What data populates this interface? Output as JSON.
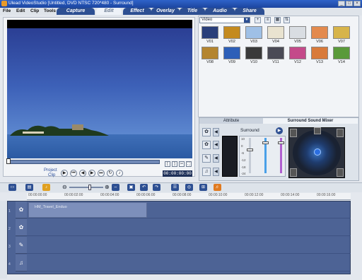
{
  "window": {
    "title": "Ulead VideoStudio [Untitled, DVD NTSC 720*480 - Surround]",
    "min": "_",
    "max": "□",
    "close": "×"
  },
  "menu": {
    "items": [
      "File",
      "Edit",
      "Clip",
      "Tools"
    ]
  },
  "steps": {
    "tabs": [
      "Capture",
      "Edit",
      "Effect",
      "Overlay",
      "Title",
      "Audio",
      "Share"
    ]
  },
  "player": {
    "mode_project": "Project",
    "mode_clip": "Clip",
    "timecode": "00:00:00:00",
    "trim_start": "[",
    "trim_end": "]"
  },
  "library": {
    "category": "Video",
    "thumbnails": [
      {
        "label": "V01",
        "color": "#2a3f7a"
      },
      {
        "label": "V02",
        "color": "#c48a1f"
      },
      {
        "label": "V03",
        "color": "#9fc0e6"
      },
      {
        "label": "V04",
        "color": "#e9e3d0"
      },
      {
        "label": "V05",
        "color": "#d9dde2"
      },
      {
        "label": "V06",
        "color": "#e38a4e"
      },
      {
        "label": "V07",
        "color": "#d7b44a"
      },
      {
        "label": "V08",
        "color": "#b48530"
      },
      {
        "label": "V09",
        "color": "#2d5fb8"
      },
      {
        "label": "V10",
        "color": "#3a3a3a"
      },
      {
        "label": "V11",
        "color": "#4a4a55"
      },
      {
        "label": "V12",
        "color": "#c44a8a"
      },
      {
        "label": "V13",
        "color": "#d87a3a"
      },
      {
        "label": "V14",
        "color": "#5a9a3a"
      }
    ]
  },
  "options": {
    "tab_attribute": "Attribute",
    "tab_surround": "Surround Sound Mixer",
    "mode": "Surround",
    "scale": [
      "10",
      "0",
      "-6",
      "-12",
      "-18",
      "-24"
    ]
  },
  "timeline": {
    "ruler": [
      "00:00:00:00",
      "00:00:02:00",
      "00:00:04:00",
      "00:00:06:00",
      "00:00:08:00",
      "00:00:10:00",
      "00:00:12:00",
      "00:00:14:00",
      "00:00:16:00"
    ],
    "clip_name": "HM_Travel_Enduo",
    "track_labels": [
      "1",
      "2",
      "3",
      "4"
    ]
  }
}
